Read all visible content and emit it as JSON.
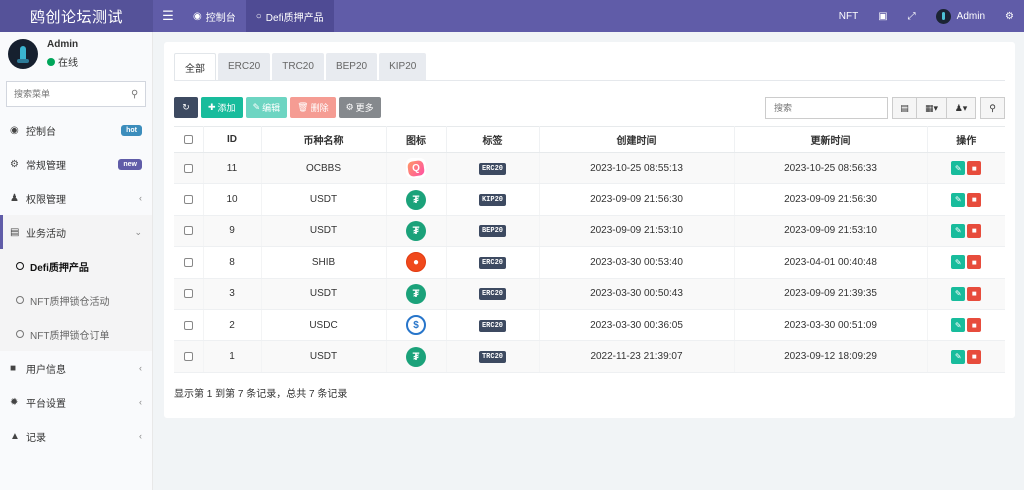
{
  "app": {
    "brand": "鸥创论坛测试"
  },
  "topnav": {
    "items": [
      {
        "label": "控制台",
        "icon": "dashboard-icon"
      },
      {
        "label": "Defi质押产品",
        "icon": "circle-icon"
      }
    ],
    "right": {
      "nft": "NFT",
      "admin": "Admin"
    }
  },
  "sidebar": {
    "user": {
      "name": "Admin",
      "status": "在线"
    },
    "search_placeholder": "搜索菜单",
    "items": [
      {
        "label": "控制台",
        "badge": "hot"
      },
      {
        "label": "常规管理",
        "badge": "new"
      },
      {
        "label": "权限管理"
      },
      {
        "label": "业务活动"
      },
      {
        "label": "用户信息"
      },
      {
        "label": "平台设置"
      },
      {
        "label": "记录"
      }
    ],
    "subitems": [
      {
        "label": "Defi质押产品"
      },
      {
        "label": "NFT质押锁仓活动"
      },
      {
        "label": "NFT质押锁仓订单"
      }
    ]
  },
  "tabs": [
    "全部",
    "ERC20",
    "TRC20",
    "BEP20",
    "KIP20"
  ],
  "toolbar": {
    "add": "添加",
    "edit": "编辑",
    "delete": "删除",
    "more": "更多",
    "search_placeholder": "搜索"
  },
  "table": {
    "headers": [
      "ID",
      "币种名称",
      "图标",
      "标签",
      "创建时间",
      "更新时间",
      "操作"
    ],
    "rows": [
      {
        "id": "11",
        "name": "OCBBS",
        "icon": "ocbbs",
        "tag": "ERC20",
        "created": "2023-10-25 08:55:13",
        "updated": "2023-10-25 08:56:33"
      },
      {
        "id": "10",
        "name": "USDT",
        "icon": "usdt",
        "tag": "KIP20",
        "created": "2023-09-09 21:56:30",
        "updated": "2023-09-09 21:56:30"
      },
      {
        "id": "9",
        "name": "USDT",
        "icon": "usdt",
        "tag": "BEP20",
        "created": "2023-09-09 21:53:10",
        "updated": "2023-09-09 21:53:10"
      },
      {
        "id": "8",
        "name": "SHIB",
        "icon": "shib",
        "tag": "ERC20",
        "created": "2023-03-30 00:53:40",
        "updated": "2023-04-01 00:40:48"
      },
      {
        "id": "3",
        "name": "USDT",
        "icon": "usdt",
        "tag": "ERC20",
        "created": "2023-03-30 00:50:43",
        "updated": "2023-09-09 21:39:35"
      },
      {
        "id": "2",
        "name": "USDC",
        "icon": "usdc",
        "tag": "ERC20",
        "created": "2023-03-30 00:36:05",
        "updated": "2023-03-30 00:51:09"
      },
      {
        "id": "1",
        "name": "USDT",
        "icon": "usdt",
        "tag": "TRC20",
        "created": "2022-11-23 21:39:07",
        "updated": "2023-09-12 18:09:29"
      }
    ]
  },
  "pagination": {
    "summary": "显示第 1 到第 7 条记录，总共 7 条记录"
  },
  "colors": {
    "header": "#605ca8",
    "accent_green": "#18bc9c",
    "danger": "#e74c3c",
    "tag_bg": "#3d4a61"
  }
}
